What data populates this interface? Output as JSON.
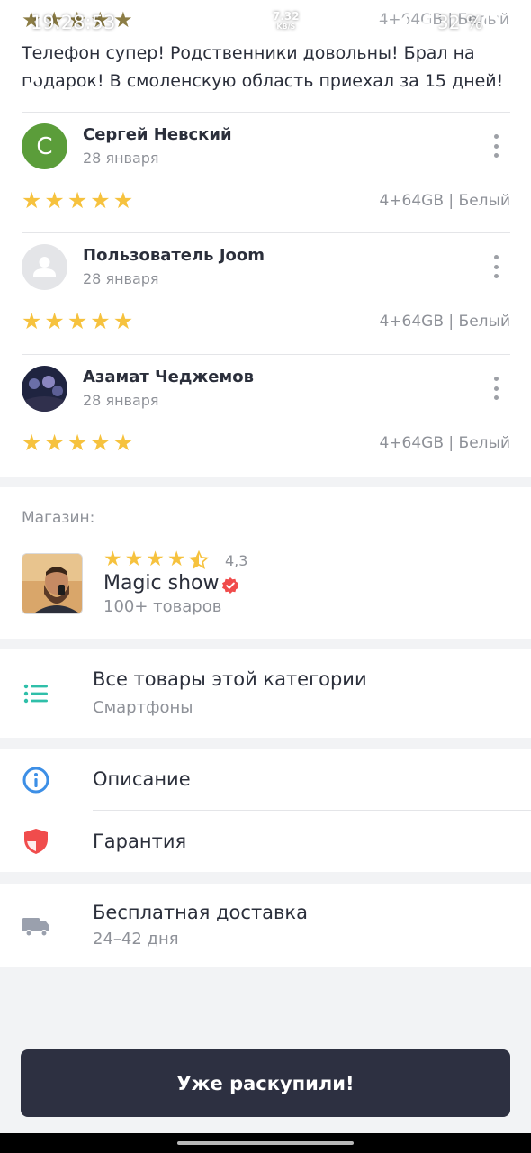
{
  "status_bar": {
    "time": "19:28:53",
    "net_speed": "7.32",
    "net_unit": "KB/S",
    "battery": "32 %"
  },
  "prev_review": {
    "variant": "4+64GB | Белый",
    "text": "Телефон супер! Родственники довольны! Брал на подарок! В смоленскую область приехал за 15 дней!"
  },
  "reviews": [
    {
      "avatar_letter": "С",
      "avatar_color": "#5b9d3a",
      "name": "Сергей Невский",
      "date": "28 января",
      "stars": 5,
      "variant": "4+64GB | Белый"
    },
    {
      "avatar_letter": "",
      "avatar_color": "#e4e5e8",
      "name": "Пользователь Joom",
      "date": "28 января",
      "stars": 5,
      "variant": "4+64GB | Белый"
    },
    {
      "avatar_letter": "",
      "avatar_color": "",
      "name": "Азамат Чеджемов",
      "date": "28 января",
      "stars": 5,
      "variant": "4+64GB | Белый"
    }
  ],
  "shop": {
    "label": "Магазин:",
    "rating": "4,3",
    "rating_value": 4.3,
    "name": "Magic show",
    "count": "100+ товаров"
  },
  "category": {
    "title": "Все товары этой категории",
    "subtitle": "Смартфоны",
    "icon": "list-icon"
  },
  "info": {
    "description": "Описание",
    "warranty": "Гарантия"
  },
  "delivery": {
    "title": "Бесплатная доставка",
    "days": "24–42 дня"
  },
  "cta": {
    "label": "Уже раскупили!"
  },
  "colors": {
    "star": "#f6c23e",
    "accent_teal": "#2fbfa9",
    "info_blue": "#3d8fe6",
    "shield_red": "#f04c4c",
    "cta_bg": "#2d3041",
    "verified_red": "#f04c4c"
  }
}
